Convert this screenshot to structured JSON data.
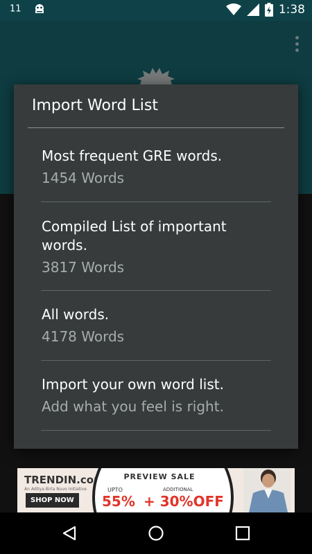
{
  "status_bar": {
    "left_text": "11",
    "time": "1:38",
    "icons": [
      "ghost-notification-icon",
      "wifi-icon",
      "cell-signal-icon",
      "battery-charging-icon"
    ]
  },
  "app_bar": {
    "overflow_icon": "more-vert-icon"
  },
  "dialog": {
    "title": "Import Word List",
    "items": [
      {
        "title": "Most frequent GRE words.",
        "subtitle": "1454 Words"
      },
      {
        "title": "Compiled List of important words.",
        "subtitle": "3817 Words"
      },
      {
        "title": "All words.",
        "subtitle": "4178 Words"
      },
      {
        "title": "Import your own word list.",
        "subtitle": "Add what you feel is right."
      }
    ]
  },
  "ad": {
    "brand": "TRENDIN.com",
    "tagline": "An Aditya Birla Nuvo Initiative",
    "shop_now": "SHOP NOW",
    "preview": "PREVIEW SALE",
    "upto": "UPTO",
    "discount": "55%",
    "additional": "ADDITIONAL",
    "extra": "+ 30%OFF"
  },
  "nav_bar": {
    "icons": [
      "back-icon",
      "home-icon",
      "recents-icon"
    ]
  },
  "colors": {
    "status_bar": "#0e4248",
    "app_bar": "#1a6d77",
    "dialog": "#373b3c",
    "accent_red": "#e2342a"
  }
}
